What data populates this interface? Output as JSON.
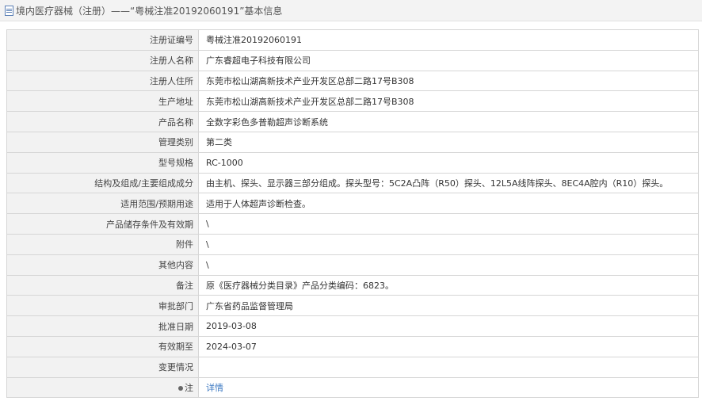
{
  "header": {
    "title": "境内医疗器械（注册）——“粤械注准20192060191”基本信息"
  },
  "rows": [
    {
      "label": "注册证编号",
      "value": "粤械注准20192060191"
    },
    {
      "label": "注册人名称",
      "value": "广东睿超电子科技有限公司"
    },
    {
      "label": "注册人住所",
      "value": "东莞市松山湖高新技术产业开发区总部二路17号B308"
    },
    {
      "label": "生产地址",
      "value": "东莞市松山湖高新技术产业开发区总部二路17号B308"
    },
    {
      "label": "产品名称",
      "value": "全数字彩色多普勒超声诊断系统"
    },
    {
      "label": "管理类别",
      "value": "第二类"
    },
    {
      "label": "型号规格",
      "value": "RC-1000"
    },
    {
      "label": "结构及组成/主要组成成分",
      "value": "由主机、探头、显示器三部分组成。探头型号：5C2A凸阵（R50）探头、12L5A线阵探头、8EC4A腔内（R10）探头。"
    },
    {
      "label": "适用范围/预期用途",
      "value": "适用于人体超声诊断检查。"
    },
    {
      "label": "产品储存条件及有效期",
      "value": "\\"
    },
    {
      "label": "附件",
      "value": "\\"
    },
    {
      "label": "其他内容",
      "value": "\\"
    },
    {
      "label": "备注",
      "value": "原《医疗器械分类目录》产品分类编码：6823。"
    },
    {
      "label": "审批部门",
      "value": "广东省药品监督管理局"
    },
    {
      "label": "批准日期",
      "value": "2019-03-08"
    },
    {
      "label": "有效期至",
      "value": "2024-03-07"
    },
    {
      "label": "变更情况",
      "value": ""
    }
  ],
  "note": {
    "label": "注",
    "link": "详情",
    "icon": "pin-icon"
  }
}
